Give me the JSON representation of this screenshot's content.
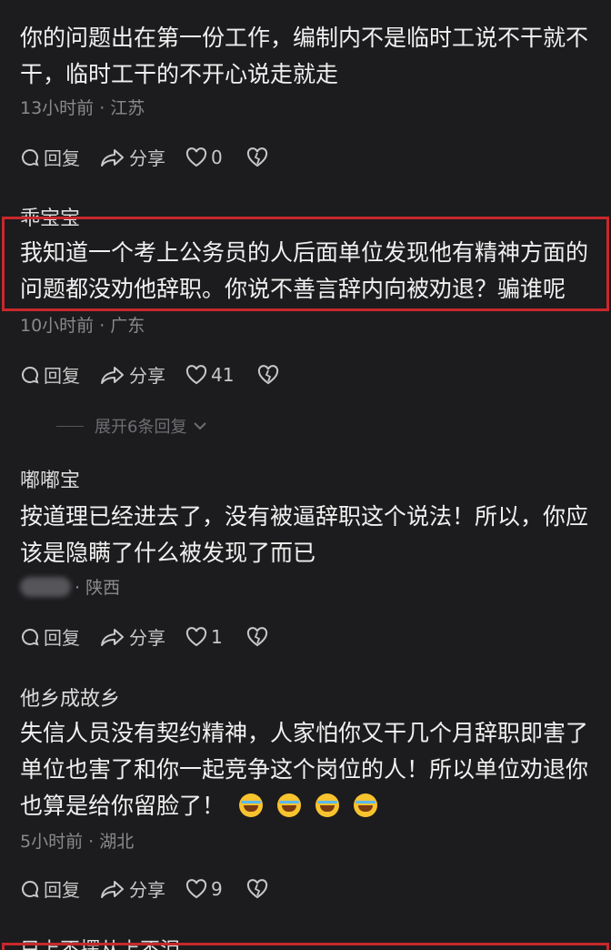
{
  "actions": {
    "reply": "回复",
    "share": "分享"
  },
  "colors": {
    "background": "#1c1c1e",
    "highlight": "#c8282c"
  },
  "comments": [
    {
      "author": "",
      "text": "你的问题出在第一份工作，编制内不是临时工说不干就不干，临时工干的不开心说走就走",
      "meta": "13小时前 · 江苏",
      "likes": "0"
    },
    {
      "author": "乖宝宝",
      "text": "我知道一个考上公务员的人后面单位发现他有精神方面的问题都没劝他辞职。你说不善言辞内向被劝退？骗谁呢",
      "meta": "10小时前 · 广东",
      "likes": "41",
      "expand": "展开6条回复"
    },
    {
      "author": "嘟嘟宝",
      "text": "按道理已经进去了，没有被逼辞职这个说法！所以，你应该是隐瞒了什么被发现了而已",
      "meta": "· 陕西",
      "likes": "1"
    },
    {
      "author": "他乡成故乡",
      "text": "失信人员没有契约精神，人家怕你又干几个月辞职即害了单位也害了和你一起竞争这个岗位的人！所以单位劝退你也算是给你留脸了！",
      "meta": "5小时前 · 湖北",
      "likes": "9",
      "emoji": "laugh-cry-icon"
    },
    {
      "author": "只上不摆从上不泪"
    }
  ]
}
